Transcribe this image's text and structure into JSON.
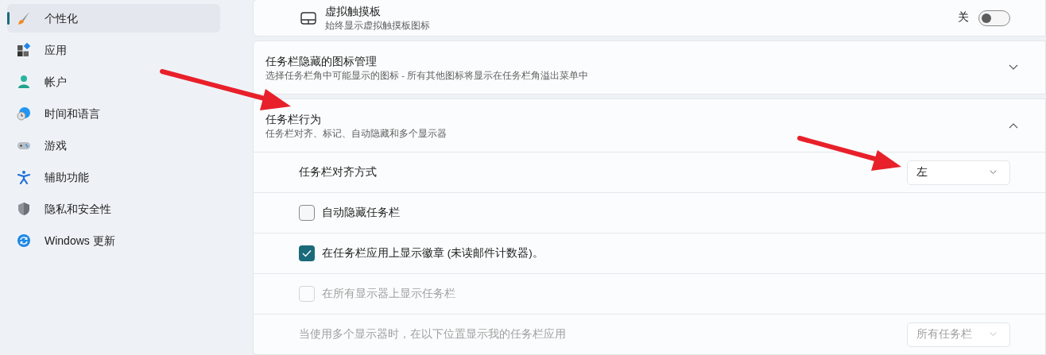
{
  "sidebar": {
    "items": [
      {
        "label": "个性化",
        "selected": true
      },
      {
        "label": "应用",
        "selected": false
      },
      {
        "label": "帐户",
        "selected": false
      },
      {
        "label": "时间和语言",
        "selected": false
      },
      {
        "label": "游戏",
        "selected": false
      },
      {
        "label": "辅助功能",
        "selected": false
      },
      {
        "label": "隐私和安全性",
        "selected": false
      },
      {
        "label": "Windows 更新",
        "selected": false
      }
    ]
  },
  "cards": [
    {
      "kind": "toggle",
      "title": "虚拟触摸板",
      "subtitle": "始终显示虚拟触摸板图标",
      "state_label": "关",
      "on": false
    },
    {
      "kind": "expander",
      "title": "任务栏隐藏的图标管理",
      "subtitle": "选择任务栏角中可能显示的图标 - 所有其他图标将显示在任务栏角溢出菜单中",
      "expanded": false
    },
    {
      "kind": "expander",
      "title": "任务栏行为",
      "subtitle": "任务栏对齐、标记、自动隐藏和多个显示器",
      "expanded": true,
      "children": [
        {
          "kind": "dropdown",
          "label": "任务栏对齐方式",
          "value": "左",
          "disabled": false
        },
        {
          "kind": "checkbox",
          "label": "自动隐藏任务栏",
          "checked": false,
          "disabled": false
        },
        {
          "kind": "checkbox",
          "label": "在任务栏应用上显示徽章 (未读邮件计数器)。",
          "checked": true,
          "disabled": false
        },
        {
          "kind": "checkbox",
          "label": "在所有显示器上显示任务栏",
          "checked": false,
          "disabled": true
        },
        {
          "kind": "dropdown",
          "label": "当使用多个显示器时，在以下位置显示我的任务栏应用",
          "value": "所有任务栏",
          "disabled": true
        }
      ]
    }
  ]
}
